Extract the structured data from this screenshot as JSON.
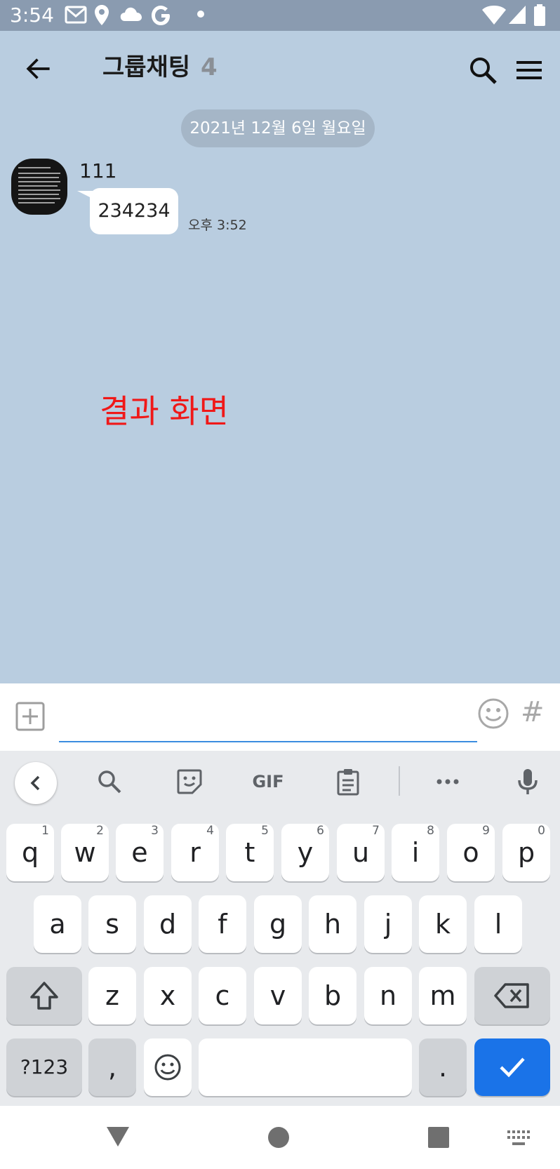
{
  "status_bar": {
    "time": "3:54"
  },
  "header": {
    "title": "그룹채팅",
    "member_count": "4"
  },
  "date_divider": "2021년 12월 6일 월요일",
  "messages": [
    {
      "sender": "111",
      "text": "234234",
      "time": "오후 3:52"
    }
  ],
  "caption": "결과 화면",
  "input": {
    "placeholder": "",
    "hash_label": "#"
  },
  "toolbar": {
    "gif_label": "GIF"
  },
  "keyboard": {
    "row1": [
      {
        "key": "q",
        "hint": "1"
      },
      {
        "key": "w",
        "hint": "2"
      },
      {
        "key": "e",
        "hint": "3"
      },
      {
        "key": "r",
        "hint": "4"
      },
      {
        "key": "t",
        "hint": "5"
      },
      {
        "key": "y",
        "hint": "6"
      },
      {
        "key": "u",
        "hint": "7"
      },
      {
        "key": "i",
        "hint": "8"
      },
      {
        "key": "o",
        "hint": "9"
      },
      {
        "key": "p",
        "hint": "0"
      }
    ],
    "row2": [
      "a",
      "s",
      "d",
      "f",
      "g",
      "h",
      "j",
      "k",
      "l"
    ],
    "row3": [
      "z",
      "x",
      "c",
      "v",
      "b",
      "n",
      "m"
    ],
    "symbols_label": "?123",
    "comma_label": ",",
    "period_label": "."
  },
  "colors": {
    "chat_background": "#b9cde0",
    "caption": "#f01818",
    "enter_key": "#1a73e8",
    "status_bar": "#8a9bb0"
  }
}
